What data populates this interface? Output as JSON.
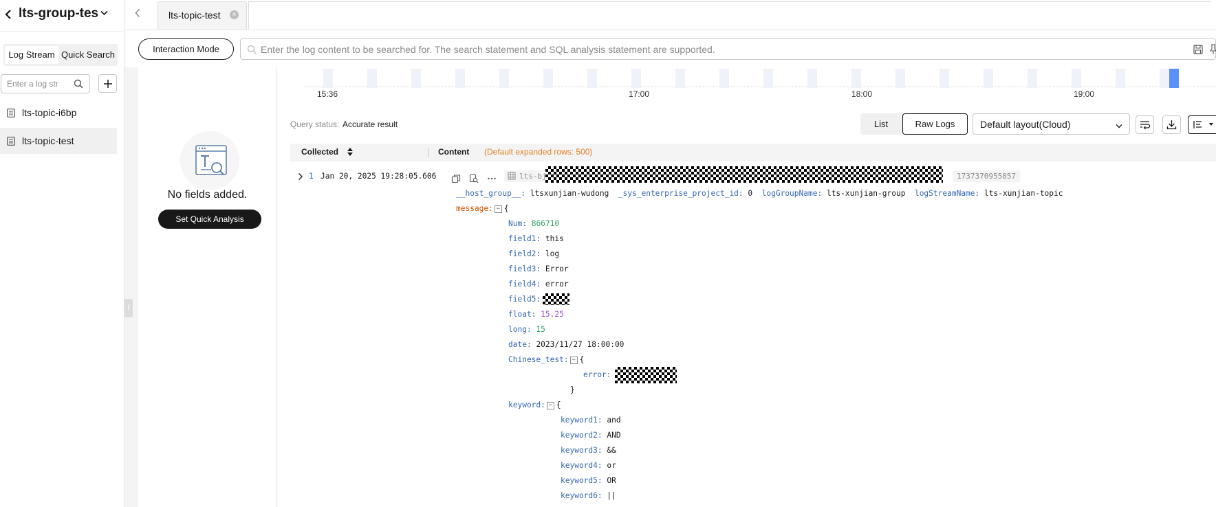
{
  "sidebar": {
    "title": "lts-group-tes",
    "tabs": [
      "Log Stream",
      "Quick Search"
    ],
    "search_placeholder": "Enter a log str",
    "items": [
      {
        "label": "lts-topic-i6bp",
        "active": false
      },
      {
        "label": "lts-topic-test",
        "active": true
      }
    ]
  },
  "tabbar": {
    "tab_label": "lts-topic-test"
  },
  "query": {
    "mode_button": "Interaction Mode",
    "placeholder": "Enter the log content to be searched for. The search statement and SQL analysis statement are supported."
  },
  "quick_analysis": {
    "empty_text": "No fields added.",
    "button": "Set Quick Analysis"
  },
  "histogram": {
    "ticks": [
      "15:36",
      "17:00",
      "18:00",
      "19:00"
    ]
  },
  "status": {
    "label": "Query status:",
    "value": "Accurate result"
  },
  "view": {
    "list": "List",
    "raw": "Raw Logs",
    "layout": "Default layout(Cloud)"
  },
  "log_table": {
    "header_collected": "Collected",
    "header_content": "Content",
    "header_note": "(Default expanded rows: 500)"
  },
  "log": {
    "index": "1",
    "time": "Jan 20, 2025 19:28:05.606",
    "stream_chip": "lts-bj",
    "meta_chip": "1737370955057",
    "host_group_key": "__host_group__:",
    "host_group_val": "ltsxunjian-wudong",
    "sys_key": "_sys_enterprise_project_id:",
    "sys_val": "0",
    "group_key": "logGroupName:",
    "group_val": "lts-xunjian-group",
    "stream_key": "logStreamName:",
    "stream_val": "lts-xunjian-topic",
    "message_key": "message:",
    "open_brace": "{",
    "close_brace": "}",
    "fields": [
      {
        "k": "Num:",
        "v": "866710",
        "t": "num"
      },
      {
        "k": "field1:",
        "v": "this",
        "t": "str"
      },
      {
        "k": "field2:",
        "v": "log",
        "t": "str"
      },
      {
        "k": "field3:",
        "v": "Error",
        "t": "str"
      },
      {
        "k": "field4:",
        "v": "error",
        "t": "str"
      },
      {
        "k": "field5:",
        "v": "",
        "t": "str"
      },
      {
        "k": "float:",
        "v": "15.25",
        "t": "flt"
      },
      {
        "k": "long:",
        "v": "15",
        "t": "num"
      },
      {
        "k": "date:",
        "v": "2023/11/27 18:00:00",
        "t": "str"
      }
    ],
    "chinese_key": "Chinese_test:",
    "error_key": "error:",
    "error_val": "",
    "keyword_key": "keyword:",
    "keywords": [
      {
        "k": "keyword1:",
        "v": "and"
      },
      {
        "k": "keyword2:",
        "v": "AND"
      },
      {
        "k": "keyword3:",
        "v": "&&"
      },
      {
        "k": "keyword4:",
        "v": "or"
      },
      {
        "k": "keyword5:",
        "v": "OR"
      },
      {
        "k": "keyword6:",
        "v": "||"
      }
    ]
  }
}
